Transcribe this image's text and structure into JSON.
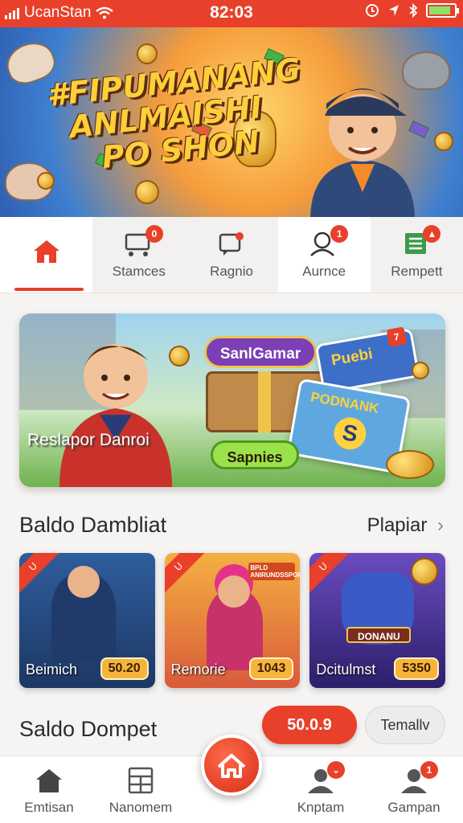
{
  "status_bar": {
    "carrier": "UcanStan",
    "time": "82:03",
    "battery_level": 0.85
  },
  "hero": {
    "title_lines": [
      "#FIPUMANANG",
      "ANLMAISHI",
      "PO SHON"
    ]
  },
  "top_tabs": [
    {
      "label": "",
      "icon": "home-icon",
      "active": true,
      "badge": ""
    },
    {
      "label": "Stamces",
      "icon": "cart-icon",
      "active": false,
      "badge": "0"
    },
    {
      "label": "Ragnio",
      "icon": "chat-icon",
      "active": false,
      "badge": ""
    },
    {
      "label": "Aurnce",
      "icon": "person-search-icon",
      "active": false,
      "badge": "1"
    },
    {
      "label": "Rempett",
      "icon": "list-icon",
      "active": false,
      "badge": "▲"
    }
  ],
  "promo": {
    "caption": "Reslapor Danroi",
    "badge_top": "SanlGamar",
    "badge_bottom": "Sapnies",
    "tile_top": "Puebi",
    "tile_top_mark": "7",
    "tile_map": "PODNANK",
    "tile_map_letter": "S"
  },
  "section": {
    "title": "Baldo Dambliat",
    "more_label": "Plapiar",
    "more_icon": "chevron-right-icon"
  },
  "games": [
    {
      "name": "Beimich",
      "value": "50.20",
      "ribbon": "U"
    },
    {
      "name": "Remorie",
      "value": "1043",
      "ribbon": "U",
      "banner": "BPLD ANIRUNDSSPORTISEDAOR"
    },
    {
      "name": "Dcitulmst",
      "value": "5350",
      "ribbon": "U",
      "banner": "DONANU"
    }
  ],
  "wallet": {
    "title": "Saldo Dompet",
    "amount": "50.0.9",
    "button_label": "Temallv"
  },
  "bottom_nav": [
    {
      "label": "Emtisan",
      "icon": "home-icon",
      "badge": ""
    },
    {
      "label": "Nanomem",
      "icon": "grid-icon",
      "badge": ""
    },
    {
      "label": "Knptam",
      "icon": "person-icon",
      "badge": "⌄"
    },
    {
      "label": "Gampan",
      "icon": "person-icon",
      "badge": "1"
    }
  ],
  "colors": {
    "accent": "#e8402a",
    "battery": "#8ee26b",
    "coin": "#f6b53a"
  }
}
